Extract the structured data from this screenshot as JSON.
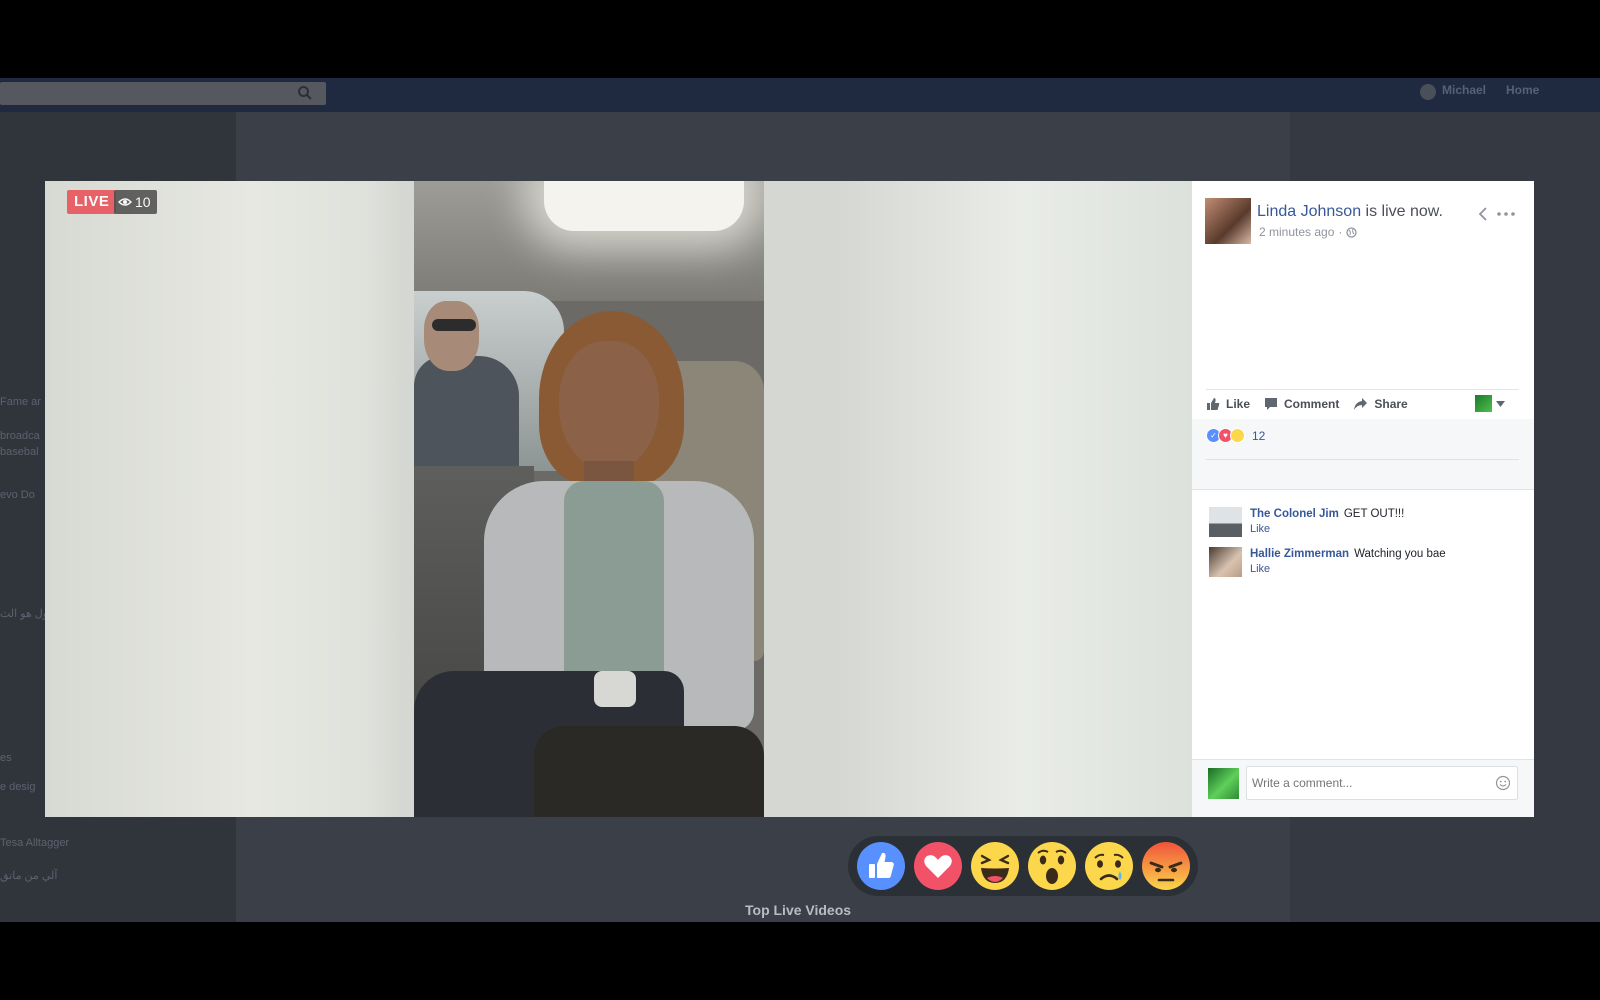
{
  "background": {
    "user_name": "Michael",
    "home_label": "Home",
    "left_col_snippets": [
      "Fame ar",
      "broadca",
      "basebal",
      "evo Do",
      "ول هو الث",
      "es",
      "e desig",
      "Tesa Alltagger",
      "آلي من ماتق"
    ],
    "top_live_label": "Top Live Videos"
  },
  "video": {
    "live_label": "LIVE",
    "viewer_count": "10"
  },
  "post": {
    "author": "Linda Johnson",
    "status": "is live now.",
    "time": "2 minutes ago",
    "actions": {
      "like": "Like",
      "comment": "Comment",
      "share": "Share"
    },
    "reaction_count": "12"
  },
  "comments": [
    {
      "author": "The Colonel Jim",
      "text": "GET OUT!!!",
      "like": "Like"
    },
    {
      "author": "Hallie Zimmerman",
      "text": "Watching you bae",
      "like": "Like"
    }
  ],
  "compose": {
    "placeholder": "Write a comment..."
  },
  "reaction_picker": [
    "like",
    "love",
    "haha",
    "wow",
    "sad",
    "angry"
  ],
  "colors": {
    "live_badge": "#ea4c55",
    "link_blue": "#365899",
    "like_blue": "#5890ff",
    "love_red": "#f25268",
    "emoji_yellow": "#fcd64b",
    "angry_red": "#f0533a"
  }
}
